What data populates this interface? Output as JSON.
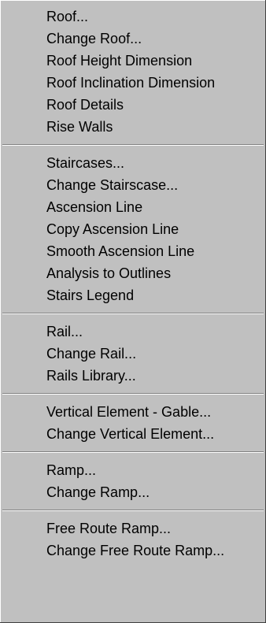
{
  "menu": {
    "groups": [
      {
        "items": [
          "Roof...",
          "Change Roof...",
          "Roof Height Dimension",
          "Roof Inclination Dimension",
          "Roof Details",
          "Rise Walls"
        ]
      },
      {
        "items": [
          "Staircases...",
          "Change Stairscase...",
          "Ascension Line",
          "Copy Ascension Line",
          "Smooth Ascension Line",
          "Analysis to Outlines",
          "Stairs Legend"
        ]
      },
      {
        "items": [
          "Rail...",
          "Change Rail...",
          "Rails Library..."
        ]
      },
      {
        "items": [
          "Vertical Element - Gable...",
          "Change Vertical Element..."
        ]
      },
      {
        "items": [
          "Ramp...",
          "Change Ramp..."
        ]
      },
      {
        "items": [
          "Free Route Ramp...",
          "Change Free Route Ramp..."
        ]
      }
    ]
  },
  "colors": {
    "menu_background": "#c0c0c0",
    "text": "#000000",
    "separator_dark": "#808080",
    "separator_light": "#ffffff"
  }
}
